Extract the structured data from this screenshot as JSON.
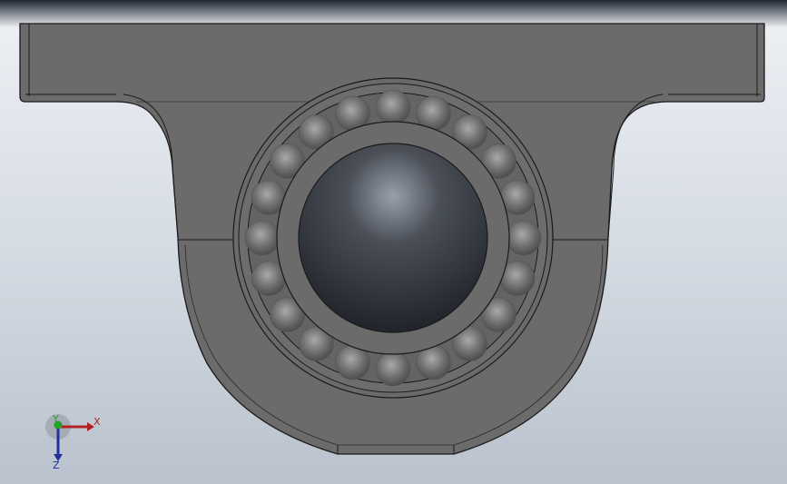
{
  "viewport": {
    "background_top": "#eef1f5",
    "background_bottom": "#b9c2cd",
    "part": {
      "name": "pillow-block-bearing",
      "body_color": "#6a6a6a",
      "edge_color": "#1a1a1a",
      "bore_color": "#2b2f36",
      "ball_count": 20
    }
  },
  "triad": {
    "x_label": "X",
    "y_label": "Y",
    "z_label": "Z",
    "x_color": "#b22222",
    "y_color": "#22a32a",
    "z_color": "#1f2f9e"
  }
}
